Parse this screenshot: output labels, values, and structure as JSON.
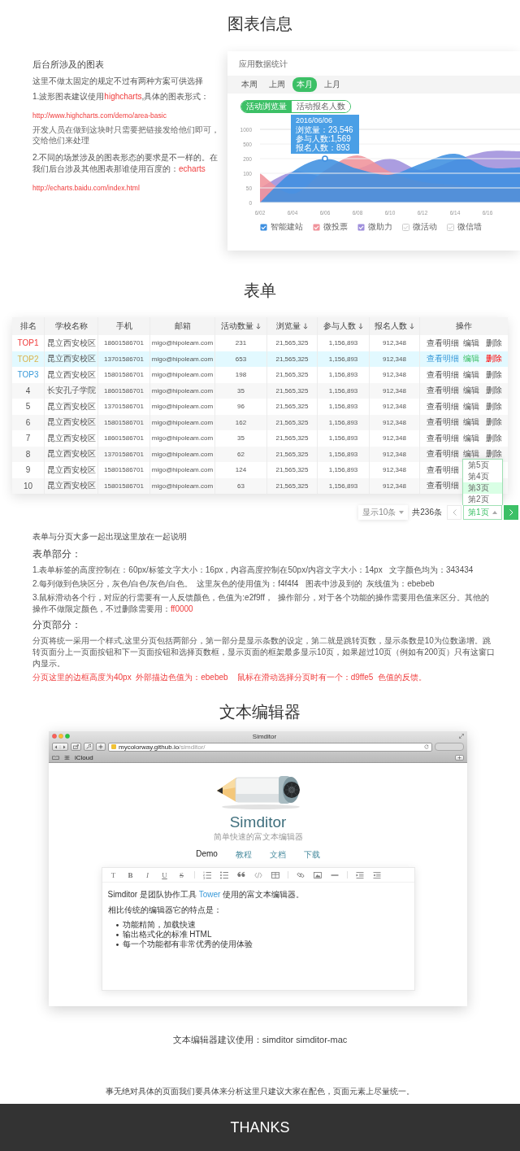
{
  "chart_section": {
    "heading": "图表信息",
    "intro": {
      "title": "后台所涉及的图表",
      "paragraphs": [
        {
          "kind": "body",
          "segments": [
            {
              "text": "这里不做太固定的规定不过有两种方案可供选择",
              "accent": false
            }
          ]
        },
        {
          "kind": "body",
          "segments": [
            {
              "text": "1.波形图表建议使用",
              "accent": false
            },
            {
              "text": "highcharts",
              "accent": true
            },
            {
              "text": ",具体的图表形式：",
              "accent": false
            }
          ]
        },
        {
          "kind": "link",
          "segments": [
            {
              "text": "http://www.highcharts.com/demo/area-basic",
              "accent": true
            }
          ]
        },
        {
          "kind": "small",
          "segments": [
            {
              "text": "开发人员在做到这块时只需要把链接发给他们即可，交给他们来处理",
              "accent": false
            }
          ]
        },
        {
          "kind": "body",
          "segments": [
            {
              "text": "2.不同的场景涉及的图表形态的要求是不一样的。在我们后台涉及其他图表那谁使用百度的：",
              "accent": false
            },
            {
              "text": "echarts",
              "accent": true
            }
          ]
        },
        {
          "kind": "link",
          "segments": [
            {
              "text": "http://echarts.baidu.com/index.html",
              "accent": true
            }
          ]
        }
      ]
    },
    "card": {
      "title": "应用数据统计",
      "periods": [
        {
          "label": "本周",
          "selected": false
        },
        {
          "label": "上周",
          "selected": false
        },
        {
          "label": "本月",
          "selected": true
        },
        {
          "label": "上月",
          "selected": false
        }
      ],
      "metrics": [
        {
          "label": "活动浏览量",
          "selected": true
        },
        {
          "label": "活动报名人数",
          "selected": false
        }
      ],
      "chart": {
        "y_labels": [
          "1000",
          "500",
          "200",
          "100",
          "50",
          "0"
        ],
        "x_labels": [
          "6/02",
          "6/04",
          "6/06",
          "6/08",
          "6/10",
          "6/12",
          "6/14",
          "6/16"
        ]
      },
      "tooltip": {
        "title": "2016/06/06",
        "lines": [
          "浏览量：23,546",
          "参与人数:1,569",
          "报名人数：893"
        ]
      },
      "legend": [
        {
          "label": "智能建站",
          "checked": true,
          "color": "#3d8fe0"
        },
        {
          "label": "微投票",
          "checked": true,
          "color": "#f0939b"
        },
        {
          "label": "微助力",
          "checked": true,
          "color": "#9f8fdc"
        },
        {
          "label": "微活动",
          "checked": false
        },
        {
          "label": "微信墙",
          "checked": false
        }
      ]
    }
  },
  "table_section": {
    "heading": "表单",
    "columns": [
      {
        "label": "排名",
        "sortable": false
      },
      {
        "label": "学校名称",
        "sortable": false
      },
      {
        "label": "手机",
        "sortable": false
      },
      {
        "label": "邮箱",
        "sortable": false
      },
      {
        "label": "活动数量",
        "sortable": true
      },
      {
        "label": "浏览量",
        "sortable": true
      },
      {
        "label": "参与人数",
        "sortable": true
      },
      {
        "label": "报名人数",
        "sortable": true
      },
      {
        "label": "操作",
        "sortable": false
      }
    ],
    "rows": [
      {
        "rank": "TOP1",
        "color": "#f03c3c",
        "school": "昆立西安校区",
        "phone": "18601586701",
        "email": "migo@hipoleam.com",
        "activities": "231",
        "views": "21,565,325",
        "participants": "1,156,893",
        "signups": "912,348",
        "highlighted": false,
        "actions": [
          "查看明细",
          "编辑",
          "删除"
        ]
      },
      {
        "rank": "TOP2",
        "color": "#d9b24a",
        "school": "昆立西安校区",
        "phone": "13701586701",
        "email": "migo@hipoleam.com",
        "activities": "653",
        "views": "21,565,325",
        "participants": "1,156,893",
        "signups": "912,348",
        "highlighted": true,
        "actions": [
          "查看明细",
          "编辑",
          "删除"
        ]
      },
      {
        "rank": "TOP3",
        "color": "#3a9ad9",
        "school": "昆立西安校区",
        "phone": "15801586701",
        "email": "migo@hipoleam.com",
        "activities": "198",
        "views": "21,565,325",
        "participants": "1,156,893",
        "signups": "912,348",
        "highlighted": false,
        "actions": [
          "查看明细",
          "编辑",
          "删除"
        ]
      },
      {
        "rank": "4",
        "school": "长安孔子学院",
        "phone": "18601586701",
        "email": "migo@hipoleam.com",
        "activities": "35",
        "views": "21,565,325",
        "participants": "1,156,893",
        "signups": "912,348",
        "highlighted": false,
        "actions": [
          "查看明细",
          "编辑",
          "删除"
        ]
      },
      {
        "rank": "5",
        "school": "昆立西安校区",
        "phone": "13701586701",
        "email": "migo@hipoleam.com",
        "activities": "96",
        "views": "21,565,325",
        "participants": "1,156,893",
        "signups": "912,348",
        "highlighted": false,
        "actions": [
          "查看明细",
          "编辑",
          "删除"
        ]
      },
      {
        "rank": "6",
        "school": "昆立西安校区",
        "phone": "15801586701",
        "email": "migo@hipoleam.com",
        "activities": "162",
        "views": "21,565,325",
        "participants": "1,156,893",
        "signups": "912,348",
        "highlighted": false,
        "actions": [
          "查看明细",
          "编辑",
          "删除"
        ]
      },
      {
        "rank": "7",
        "school": "昆立西安校区",
        "phone": "18601586701",
        "email": "migo@hipoleam.com",
        "activities": "35",
        "views": "21,565,325",
        "participants": "1,156,893",
        "signups": "912,348",
        "highlighted": false,
        "actions": [
          "查看明细",
          "编辑",
          "删除"
        ]
      },
      {
        "rank": "8",
        "school": "昆立西安校区",
        "phone": "13701586701",
        "email": "migo@hipoleam.com",
        "activities": "62",
        "views": "21,565,325",
        "participants": "1,156,893",
        "signups": "912,348",
        "highlighted": false,
        "actions": [
          "查看明细",
          "编辑",
          "删除"
        ]
      },
      {
        "rank": "9",
        "school": "昆立西安校区",
        "phone": "15801586701",
        "email": "migo@hipoleam.com",
        "activities": "124",
        "views": "21,565,325",
        "participants": "1,156,893",
        "signups": "912,348",
        "highlighted": false,
        "actions": [
          "查看明细"
        ]
      },
      {
        "rank": "10",
        "school": "昆立西安校区",
        "phone": "15801586701",
        "email": "migo@hipoleam.com",
        "activities": "63",
        "views": "21,565,325",
        "participants": "1,156,893",
        "signups": "912,348",
        "highlighted": false,
        "actions": [
          "查看明细"
        ]
      }
    ],
    "pagination": {
      "page_size": "显示10条",
      "total": "共236条",
      "page_select": {
        "value": "第1页",
        "expanded": true,
        "options": [
          {
            "label": "第5页",
            "highlighted": false
          },
          {
            "label": "第4页",
            "highlighted": false
          },
          {
            "label": "第3页",
            "highlighted": true
          },
          {
            "label": "第2页",
            "highlighted": false
          }
        ]
      }
    }
  },
  "notes": {
    "intro": "表单与分页大多一起出现这里放在一起说明",
    "groups": [
      {
        "heading": "表单部分：",
        "paragraphs": [
          [
            {
              "text": "1.表单标签的高度控制在：60px/标签文字大小：16px，内容高度控制在50px/内容文字大小：14px   文字颜色均为：343434",
              "accent": false
            }
          ],
          [
            {
              "text": "2.每列做到色块区分，灰色/白色/灰色/白色。  这里灰色的使用值为：f4f4f4   图表中涉及到的  灰线值为：ebebeb",
              "accent": false
            }
          ],
          [
            {
              "text": "3.鼠标滑动各个行，对应的行需要有一人反馈颜色，色值为:e2f9ff，  操作部分，对于各个功能的操作需要用色值来区分。其他的操作不做限定颜色，不过删除需要用：",
              "accent": false
            },
            {
              "text": "ff0000",
              "accent": true
            }
          ]
        ]
      },
      {
        "heading": "分页部分：",
        "paragraphs": [
          [
            {
              "text": "分页将统一采用一个样式,这里分页包括两部分，第一部分是显示条数的设定，第二就是跳转页数，显示条数是10为位数递增。跳转页面分上一页面按钮和下一页面按钮和选择页数框，显示页面的框架最多显示10页，如果超过10页（例如有200页）只有这窗口内显示。",
              "accent": false
            }
          ],
          [
            {
              "text": "分页这里的边框高度为40px  外部描边色值为：ebebeb    鼠标在滑动选择分页时有一个：d9ffe5  色值的反馈。",
              "accent": true
            }
          ]
        ]
      }
    ]
  },
  "editor_section": {
    "heading": "文本编辑器",
    "browser": {
      "title": "Simditor",
      "url_host": "mycolorway.github.io",
      "url_path": "/simditor/",
      "bookmark": "iCloud",
      "page": {
        "title": "Simditor",
        "subtitle": "简单快速的富文本编辑器",
        "nav": [
          {
            "label": "Demo",
            "selected": true
          },
          {
            "label": "教程",
            "selected": false
          },
          {
            "label": "文档",
            "selected": false
          },
          {
            "label": "下载",
            "selected": false
          }
        ],
        "toolbar": [
          {
            "kind": "glyph",
            "glyph": "T"
          },
          {
            "kind": "glyph",
            "glyph": "B"
          },
          {
            "kind": "glyph",
            "glyph": "I"
          },
          {
            "kind": "glyph",
            "glyph": "U"
          },
          {
            "kind": "glyph",
            "glyph": "S"
          },
          {
            "kind": "separator"
          },
          {
            "kind": "ordered-list"
          },
          {
            "kind": "unordered-list"
          },
          {
            "kind": "quote"
          },
          {
            "kind": "code"
          },
          {
            "kind": "table"
          },
          {
            "kind": "separator"
          },
          {
            "kind": "link"
          },
          {
            "kind": "image"
          },
          {
            "kind": "rule"
          },
          {
            "kind": "separator"
          },
          {
            "kind": "indent"
          },
          {
            "kind": "outdent"
          }
        ],
        "content": [
          {
            "kind": "paragraph",
            "segments": [
              {
                "text": "Simditor 是团队协作工具 ",
                "accent": false
              },
              {
                "text": "Tower",
                "accent": true
              },
              {
                "text": " 使用的富文本编辑器。",
                "accent": false
              }
            ]
          },
          {
            "kind": "paragraph",
            "segments": [
              {
                "text": "相比传统的编辑器它的特点是：",
                "accent": false
              }
            ]
          },
          {
            "kind": "list",
            "items": [
              "功能精简，加载快速",
              "输出格式化的标准 HTML",
              "每一个功能都有非常优秀的使用体验"
            ]
          }
        ]
      }
    },
    "recommendation": "文本编辑器建议使用：simditor simditor-mac"
  },
  "closing_note": "事无绝对具体的页面我们要具体来分析这里只建议大家在配色，页面元素上尽量统一。",
  "footer": {
    "text": "THANKS"
  }
}
